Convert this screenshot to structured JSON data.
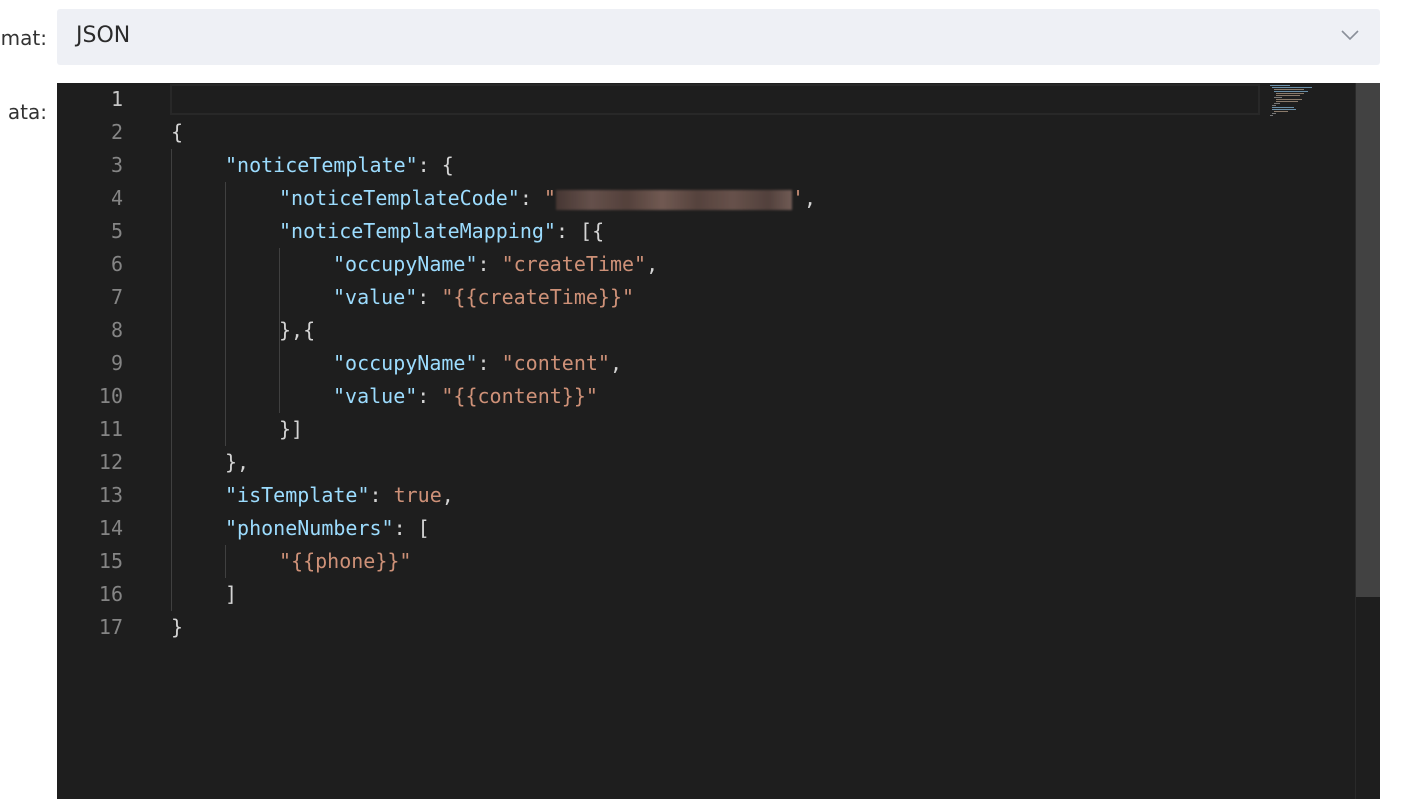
{
  "form": {
    "format_label": "mat:",
    "data_label": "ata:"
  },
  "format_select": {
    "value": "JSON",
    "icon": "chevron-down-icon"
  },
  "editor": {
    "line_numbers": [
      "1",
      "2",
      "3",
      "4",
      "5",
      "6",
      "7",
      "8",
      "9",
      "10",
      "11",
      "12",
      "13",
      "14",
      "15",
      "16",
      "17"
    ],
    "lines": [
      {
        "indent": 0,
        "tokens": []
      },
      {
        "indent": 0,
        "tokens": [
          {
            "t": "p",
            "v": "{"
          }
        ]
      },
      {
        "indent": 1,
        "tokens": [
          {
            "t": "k",
            "v": "\"noticeTemplate\""
          },
          {
            "t": "p",
            "v": ": {"
          }
        ]
      },
      {
        "indent": 2,
        "tokens": [
          {
            "t": "k",
            "v": "\"noticeTemplateCode\""
          },
          {
            "t": "p",
            "v": ": "
          },
          {
            "t": "s",
            "v": "\""
          },
          {
            "t": "r",
            "v": ""
          },
          {
            "t": "s",
            "v": "'"
          },
          {
            "t": "p",
            "v": ","
          }
        ]
      },
      {
        "indent": 2,
        "tokens": [
          {
            "t": "k",
            "v": "\"noticeTemplateMapping\""
          },
          {
            "t": "p",
            "v": ": [{"
          }
        ]
      },
      {
        "indent": 3,
        "tokens": [
          {
            "t": "k",
            "v": "\"occupyName\""
          },
          {
            "t": "p",
            "v": ": "
          },
          {
            "t": "s",
            "v": "\"createTime\""
          },
          {
            "t": "p",
            "v": ","
          }
        ]
      },
      {
        "indent": 3,
        "tokens": [
          {
            "t": "k",
            "v": "\"value\""
          },
          {
            "t": "p",
            "v": ": "
          },
          {
            "t": "s",
            "v": "\"{{createTime}}\""
          }
        ]
      },
      {
        "indent": 2,
        "tokens": [
          {
            "t": "p",
            "v": "},{"
          }
        ]
      },
      {
        "indent": 3,
        "tokens": [
          {
            "t": "k",
            "v": "\"occupyName\""
          },
          {
            "t": "p",
            "v": ": "
          },
          {
            "t": "s",
            "v": "\"content\""
          },
          {
            "t": "p",
            "v": ","
          }
        ]
      },
      {
        "indent": 3,
        "tokens": [
          {
            "t": "k",
            "v": "\"value\""
          },
          {
            "t": "p",
            "v": ": "
          },
          {
            "t": "s",
            "v": "\"{{content}}\""
          }
        ]
      },
      {
        "indent": 2,
        "tokens": [
          {
            "t": "p",
            "v": "}]"
          }
        ]
      },
      {
        "indent": 1,
        "tokens": [
          {
            "t": "p",
            "v": "},"
          }
        ]
      },
      {
        "indent": 1,
        "tokens": [
          {
            "t": "k",
            "v": "\"isTemplate\""
          },
          {
            "t": "p",
            "v": ": "
          },
          {
            "t": "b",
            "v": "true"
          },
          {
            "t": "p",
            "v": ","
          }
        ]
      },
      {
        "indent": 1,
        "tokens": [
          {
            "t": "k",
            "v": "\"phoneNumbers\""
          },
          {
            "t": "p",
            "v": ": ["
          }
        ]
      },
      {
        "indent": 2,
        "tokens": [
          {
            "t": "s",
            "v": "\"{{phone}}\""
          }
        ]
      },
      {
        "indent": 1,
        "tokens": [
          {
            "t": "p",
            "v": "]"
          }
        ]
      },
      {
        "indent": 0,
        "tokens": [
          {
            "t": "p",
            "v": "}"
          }
        ]
      }
    ],
    "active_line": "1",
    "colors": {
      "background": "#1e1e1e",
      "key": "#9cdcfe",
      "string": "#ce9178",
      "punct": "#d4d4d4",
      "line_number": "#858585"
    }
  }
}
